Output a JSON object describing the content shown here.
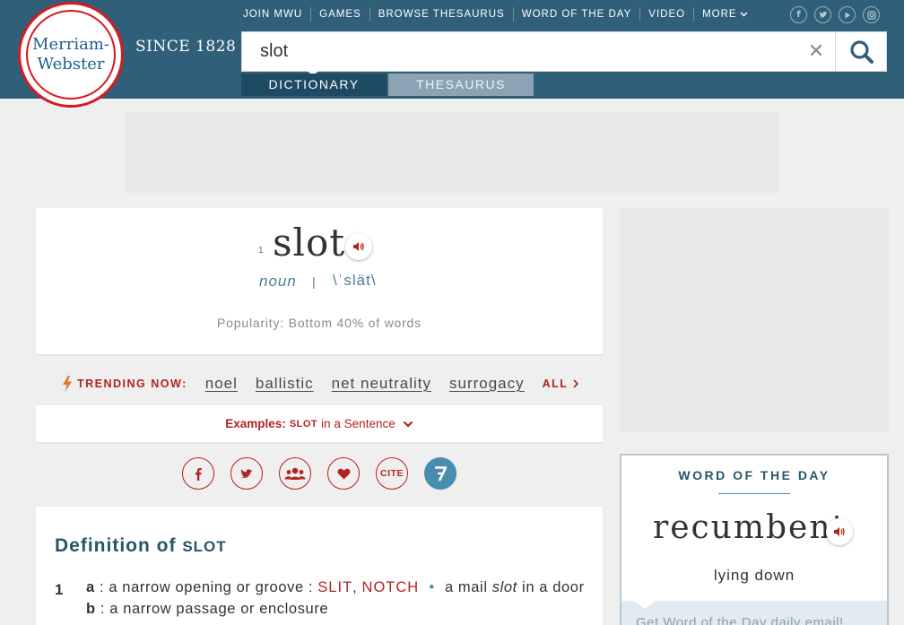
{
  "header": {
    "logo_line1": "Merriam-",
    "logo_line2": "Webster",
    "since": "SINCE 1828",
    "nav": [
      "JOIN MWU",
      "GAMES",
      "BROWSE THESAURUS",
      "WORD OF THE DAY",
      "VIDEO"
    ],
    "more_label": "MORE",
    "social_icons": [
      "facebook-icon",
      "twitter-icon",
      "youtube-icon",
      "instagram-icon"
    ],
    "colors": {
      "bar": "#305f7a",
      "brand_red": "#d71920"
    }
  },
  "search": {
    "value": "slot",
    "clear_glyph": "✕",
    "tabs": {
      "dictionary": "DICTIONARY",
      "thesaurus": "THESAURUS"
    }
  },
  "entry": {
    "homograph": "1",
    "headword": "slot",
    "part_of_speech": "noun",
    "separator": "|",
    "pronunciation": "\\ˈslät\\",
    "popularity": "Popularity: Bottom 40% of words"
  },
  "trending": {
    "label": "TRENDING NOW:",
    "words": [
      "noel",
      "ballistic",
      "net neutrality",
      "surrogacy"
    ],
    "all_label": "ALL"
  },
  "examples": {
    "label": "Examples:",
    "word": "SLOT",
    "suffix": "in a Sentence"
  },
  "share": {
    "cite_label": "CITE",
    "icons": [
      "facebook-icon",
      "twitter-icon",
      "community-icon",
      "heart-icon",
      "cite-icon",
      "seven-icon"
    ]
  },
  "definition": {
    "title": "Definition of",
    "word": "SLOT",
    "sense_number": "1",
    "a_letter": "a",
    "a_text": ": a narrow opening or groove :",
    "a_xref1": "SLIT",
    "a_comma": ",",
    "a_xref2": "NOTCH",
    "a_bullet": "•",
    "a_example_pre": "a mail",
    "a_example_word": "slot",
    "a_example_post": "in a door",
    "b_letter": "b",
    "b_text": ": a narrow passage or enclosure"
  },
  "word_of_the_day": {
    "label": "WORD OF THE DAY",
    "word": "recumbent",
    "definition": "lying down",
    "email_cta": "Get Word of the Day daily email!"
  }
}
